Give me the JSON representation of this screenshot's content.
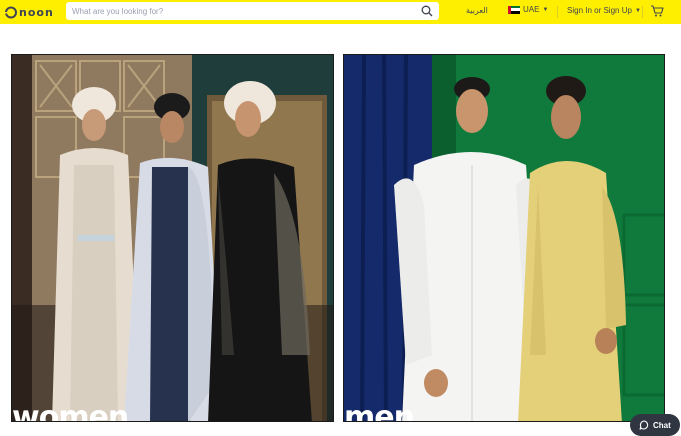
{
  "header": {
    "logo_text": "noon",
    "search_placeholder": "What are you looking for?",
    "language": "العربية",
    "country": "UAE",
    "signin": "Sign In or Sign Up"
  },
  "panels": [
    {
      "label": "women"
    },
    {
      "label": "men"
    }
  ],
  "chat": {
    "label": "Chat"
  },
  "colors": {
    "brand_yellow": "#feee00",
    "text_dark": "#404553",
    "men_background": "#0f7a3c"
  },
  "icons": [
    "noon-logo-icon",
    "search-icon",
    "uae-flag-icon",
    "chevron-down-icon",
    "cart-icon",
    "chat-icon"
  ]
}
